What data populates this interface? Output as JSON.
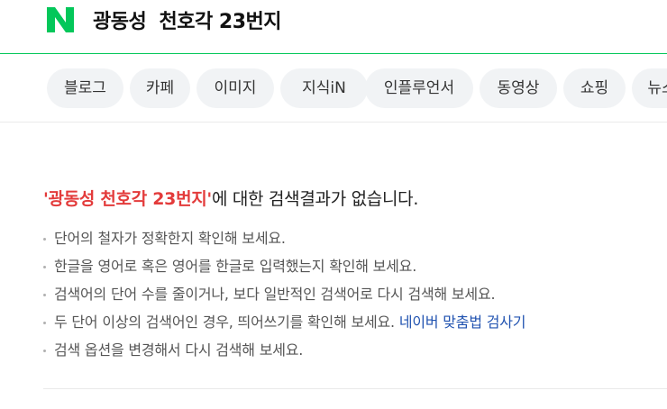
{
  "header": {
    "logo": "N",
    "query": "광동성  천호각 23번지",
    "brand_color": "#03c75a"
  },
  "tabs": [
    {
      "label": "블로그"
    },
    {
      "label": "카페"
    },
    {
      "label": "이미지"
    },
    {
      "label": "지식iN"
    },
    {
      "label": "인플루언서"
    },
    {
      "label": "동영상"
    },
    {
      "label": "쇼핑"
    },
    {
      "label": "뉴스"
    }
  ],
  "result": {
    "query_quoted": "'광동성 천호각 23번지'",
    "message": "에 대한 검색결과가 없습니다.",
    "query_color": "#e33b3b"
  },
  "tips": [
    {
      "text": "단어의 철자가 정확한지 확인해 보세요."
    },
    {
      "text": "한글을 영어로 혹은 영어를 한글로 입력했는지 확인해 보세요."
    },
    {
      "text": "검색어의 단어 수를 줄이거나, 보다 일반적인 검색어로 다시 검색해 보세요."
    },
    {
      "text": "두 단어 이상의 검색어인 경우, 띄어쓰기를 확인해 보세요.",
      "link": "네이버 맞춤법 검사기"
    },
    {
      "text": "검색 옵션을 변경해서 다시 검색해 보세요."
    }
  ]
}
